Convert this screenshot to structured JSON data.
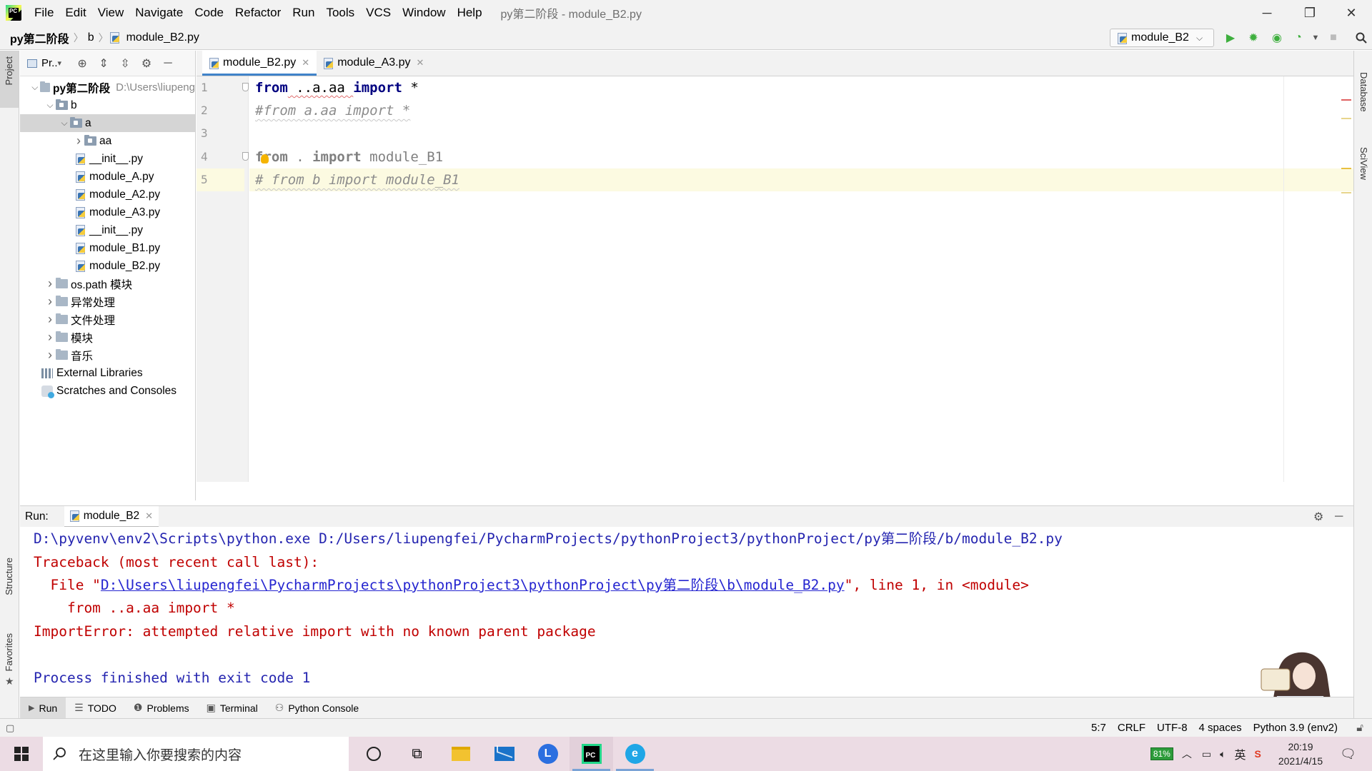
{
  "titlebar": {
    "menu": [
      "File",
      "Edit",
      "View",
      "Navigate",
      "Code",
      "Refactor",
      "Run",
      "Tools",
      "VCS",
      "Window",
      "Help"
    ],
    "window_title": "py第二阶段 - module_B2.py",
    "controls": {
      "minimize": "─",
      "restore": "❐",
      "close": "✕"
    }
  },
  "navbar": {
    "breadcrumbs": [
      "py第二阶段",
      "b",
      "module_B2.py"
    ],
    "run_config": "module_B2"
  },
  "side_tabs": {
    "left": [
      "Project",
      "Structure",
      "Favorites"
    ],
    "right": [
      "Database",
      "SciView"
    ]
  },
  "project": {
    "toolbar_label": "Pr..",
    "tree": [
      {
        "label": "py第二阶段",
        "hint": "D:\\Users\\liupeng",
        "level": 0,
        "kind": "folder",
        "arrow": "v"
      },
      {
        "label": "b",
        "level": 1,
        "kind": "pkg",
        "arrow": "v"
      },
      {
        "label": "a",
        "level": 2,
        "kind": "pkg",
        "arrow": "v",
        "selected": true
      },
      {
        "label": "aa",
        "level": 3,
        "kind": "pkg",
        "arrow": ">"
      },
      {
        "label": "__init__.py",
        "level": 4,
        "kind": "py"
      },
      {
        "label": "module_A.py",
        "level": 4,
        "kind": "py"
      },
      {
        "label": "module_A2.py",
        "level": 4,
        "kind": "py"
      },
      {
        "label": "module_A3.py",
        "level": 4,
        "kind": "py"
      },
      {
        "label": "__init__.py",
        "level": 3,
        "kind": "py"
      },
      {
        "label": "module_B1.py",
        "level": 3,
        "kind": "py"
      },
      {
        "label": "module_B2.py",
        "level": 3,
        "kind": "py"
      },
      {
        "label": "os.path 模块",
        "level": 1,
        "kind": "folder",
        "arrow": ">"
      },
      {
        "label": "异常处理",
        "level": 1,
        "kind": "folder",
        "arrow": ">"
      },
      {
        "label": "文件处理",
        "level": 1,
        "kind": "folder",
        "arrow": ">"
      },
      {
        "label": "模块",
        "level": 1,
        "kind": "folder",
        "arrow": ">"
      },
      {
        "label": "音乐",
        "level": 1,
        "kind": "folder",
        "arrow": ">"
      },
      {
        "label": "External Libraries",
        "level": 0,
        "kind": "libs"
      },
      {
        "label": "Scratches and Consoles",
        "level": 0,
        "kind": "scratch"
      }
    ]
  },
  "editor": {
    "tabs": [
      {
        "label": "module_B2.py",
        "active": true
      },
      {
        "label": "module_A3.py",
        "active": false
      }
    ],
    "line_numbers": [
      "1",
      "2",
      "3",
      "4",
      "5"
    ],
    "inspection": {
      "errors": "1",
      "warnings": "1",
      "weak_warnings": "4"
    },
    "lines": {
      "l1": {
        "kw1": "from",
        "mid": " ..a.aa ",
        "kw2": "import",
        "rest": " *"
      },
      "l2": "#from a.aa import *",
      "l4": {
        "kw1": "from",
        "mid": " . ",
        "kw2": "import",
        "rest": " module_B1"
      },
      "l5": "# from b import module_B1"
    }
  },
  "run": {
    "label": "Run:",
    "tab": "module_B2",
    "output": {
      "cmd": "D:\\pyvenv\\env2\\Scripts\\python.exe D:/Users/liupengfei/PycharmProjects/pythonProject3/pythonProject/py第二阶段/b/module_B2.py",
      "traceback": "Traceback (most recent call last):",
      "file_prefix": "  File \"",
      "file_link": "D:\\Users\\liupengfei\\PycharmProjects\\pythonProject3\\pythonProject\\py第二阶段\\b\\module_B2.py",
      "file_suffix": "\", line 1, in <module>",
      "code": "    from ..a.aa import *",
      "error": "ImportError: attempted relative import with no known parent package",
      "finished": "Process finished with exit code 1"
    }
  },
  "bottom_tabs": [
    "Run",
    "TODO",
    "Problems",
    "Terminal",
    "Python Console"
  ],
  "statusbar": {
    "position": "5:7",
    "line_sep": "CRLF",
    "encoding": "UTF-8",
    "indent": "4 spaces",
    "interpreter": "Python 3.9 (env2)"
  },
  "taskbar": {
    "search_placeholder": "在这里输入你要搜索的内容",
    "battery": "81%",
    "ime": "英",
    "time": "20:19",
    "date": "2021/4/15"
  },
  "colors": {
    "keyword": "#000080",
    "comment": "#8c8c8c",
    "error": "#c00000",
    "console_blue": "#2525b0",
    "accent": "#4083c9"
  }
}
